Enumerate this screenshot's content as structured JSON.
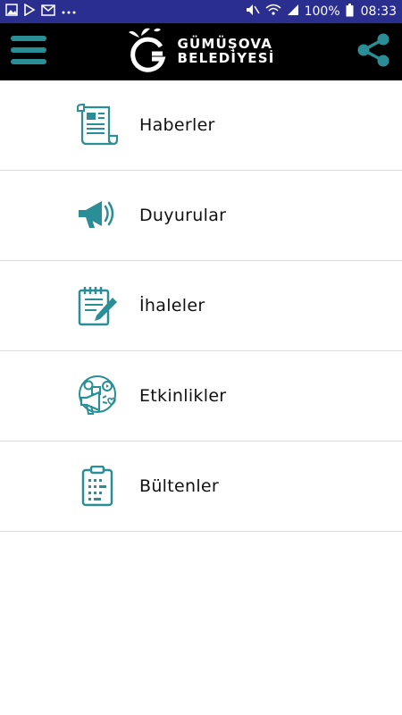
{
  "status_bar": {
    "time": "08:33",
    "battery": "100%",
    "left_icons": [
      "image-icon",
      "play-store-icon",
      "gmail-icon",
      "more-dots-icon"
    ],
    "right_icons": [
      "mute-icon",
      "wifi-icon",
      "signal-icon",
      "battery-icon"
    ]
  },
  "app_bar": {
    "logo_line1": "GÜMÜŞOVA",
    "logo_line2": "BELEDİYESİ",
    "menu_icon": "hamburger-menu-icon",
    "share_icon": "share-icon",
    "accent_color": "#2a8e96"
  },
  "menu_items": [
    {
      "label": "Haberler",
      "icon": "newspaper-icon"
    },
    {
      "label": "Duyurular",
      "icon": "megaphone-icon"
    },
    {
      "label": "İhaleler",
      "icon": "notepad-pencil-icon"
    },
    {
      "label": "Etkinlikler",
      "icon": "social-media-megaphone-icon"
    },
    {
      "label": "Bültenler",
      "icon": "clipboard-checklist-icon"
    }
  ]
}
